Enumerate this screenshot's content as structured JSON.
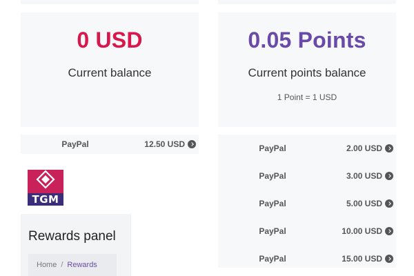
{
  "balance_card": {
    "amount": "0 USD",
    "label": "Current balance"
  },
  "points_card": {
    "amount": "0.05 Points",
    "label": "Current points balance",
    "rate": "1 Point = 1 USD"
  },
  "usd_rewards": [
    {
      "provider": "PayPal",
      "amount": "12.50 USD"
    }
  ],
  "points_rewards": [
    {
      "provider": "PayPal",
      "amount": "2.00 USD"
    },
    {
      "provider": "PayPal",
      "amount": "3.00 USD"
    },
    {
      "provider": "PayPal",
      "amount": "5.00 USD"
    },
    {
      "provider": "PayPal",
      "amount": "10.00 USD"
    },
    {
      "provider": "PayPal",
      "amount": "15.00 USD"
    }
  ],
  "logo": {
    "text": "TGM"
  },
  "panel": {
    "title": "Rewards panel",
    "breadcrumb": {
      "home": "Home",
      "separator": "/",
      "current": "Rewards"
    }
  },
  "colors": {
    "balance_accent": "#d8174c",
    "points_accent": "#6a4aa8",
    "logo_magenta": "#c9215a",
    "logo_purple": "#3b2d7a"
  },
  "icons": {
    "redeem_arrow": "chevron-right-circle-icon",
    "logo_mark": "diamond-icon"
  }
}
